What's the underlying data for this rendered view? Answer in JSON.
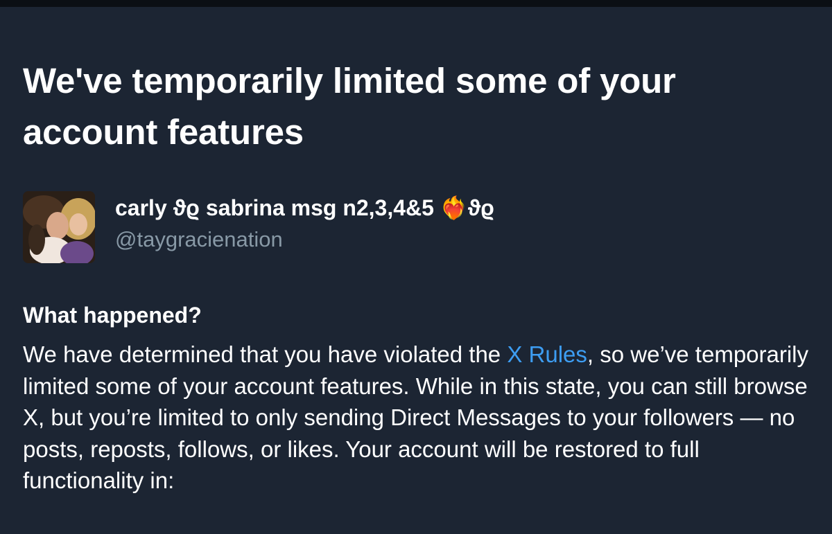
{
  "notice": {
    "title": "We've temporarily limited some of your account features"
  },
  "account": {
    "display_name": "carly ϑϱ sabrina msg n2,3,4&5 ❤️‍🔥ϑϱ",
    "handle": "@taygracienation"
  },
  "section": {
    "heading": "What happened?",
    "text_before_link": "We have determined that you have violated the ",
    "link_text": "X Rules",
    "text_after_link": ", so we’ve temporarily limited some of your account features. While in this state, you can still browse X, but you’re limited to only sending Direct Messages to your followers — no posts, reposts, follows, or likes. Your account will be restored to full functionality in:"
  },
  "colors": {
    "background": "#1c2533",
    "text": "#ffffff",
    "secondary_text": "#8899a6",
    "link": "#3d9df2"
  }
}
